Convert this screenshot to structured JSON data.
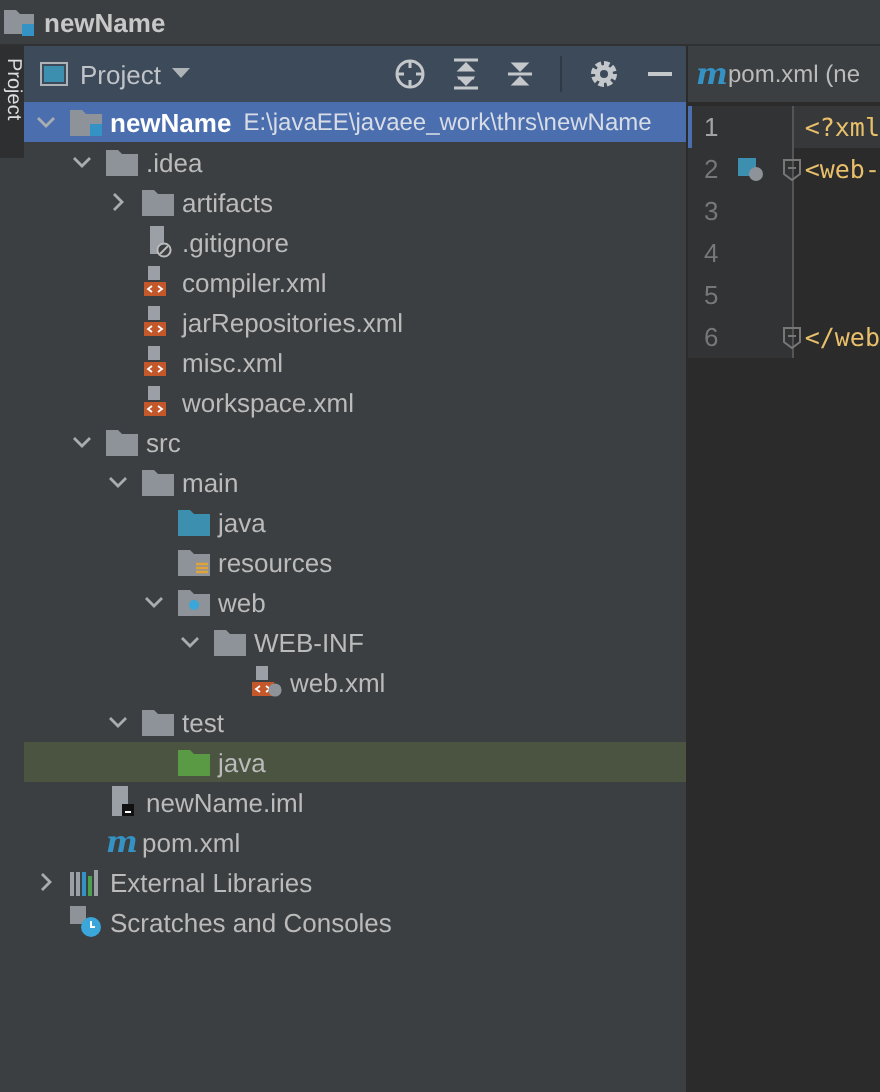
{
  "window": {
    "title": "newName"
  },
  "side_stripe": {
    "label": "Project",
    "selected": true
  },
  "panel": {
    "title": "Project",
    "toolbar": [
      {
        "kind": "locate"
      },
      {
        "kind": "expand"
      },
      {
        "kind": "collapse"
      },
      {
        "kind": "gear"
      },
      {
        "kind": "hide"
      }
    ]
  },
  "tree": [
    {
      "name": "newName",
      "path": "E:\\javaEE\\javaee_work\\thrs\\newName",
      "kind": "module",
      "expanded": true,
      "selected": true,
      "highlighted": false,
      "children": [
        {
          "name": ".idea",
          "kind": "folder",
          "expanded": true,
          "selected": false,
          "highlighted": false,
          "children": [
            {
              "name": "artifacts",
              "kind": "folder",
              "expanded": false,
              "selected": false,
              "highlighted": false
            },
            {
              "name": ".gitignore",
              "kind": "ignore",
              "selected": false,
              "highlighted": false
            },
            {
              "name": "compiler.xml",
              "kind": "xml",
              "selected": false,
              "highlighted": false
            },
            {
              "name": "jarRepositories.xml",
              "kind": "xml",
              "selected": false,
              "highlighted": false
            },
            {
              "name": "misc.xml",
              "kind": "xml",
              "selected": false,
              "highlighted": false
            },
            {
              "name": "workspace.xml",
              "kind": "xml",
              "selected": false,
              "highlighted": false
            }
          ]
        },
        {
          "name": "src",
          "kind": "folder",
          "expanded": true,
          "selected": false,
          "highlighted": false,
          "children": [
            {
              "name": "main",
              "kind": "folder",
              "expanded": true,
              "selected": false,
              "highlighted": false,
              "children": [
                {
                  "name": "java",
                  "kind": "source",
                  "selected": false,
                  "highlighted": false
                },
                {
                  "name": "resources",
                  "kind": "resources",
                  "selected": false,
                  "highlighted": false
                },
                {
                  "name": "web",
                  "kind": "web",
                  "expanded": true,
                  "selected": false,
                  "highlighted": false,
                  "children": [
                    {
                      "name": "WEB-INF",
                      "kind": "folder",
                      "expanded": true,
                      "selected": false,
                      "highlighted": false,
                      "children": [
                        {
                          "name": "web.xml",
                          "kind": "webxml",
                          "selected": false,
                          "highlighted": false
                        }
                      ]
                    }
                  ]
                }
              ]
            },
            {
              "name": "test",
              "kind": "folder",
              "expanded": true,
              "selected": false,
              "highlighted": false,
              "children": [
                {
                  "name": "java",
                  "kind": "test",
                  "selected": false,
                  "highlighted": true
                }
              ]
            }
          ]
        },
        {
          "name": "newName.iml",
          "kind": "iml",
          "selected": false,
          "highlighted": false
        },
        {
          "name": "pom.xml",
          "kind": "maven",
          "badge": "m",
          "selected": false,
          "highlighted": false
        }
      ]
    },
    {
      "name": "External Libraries",
      "kind": "libraries",
      "expanded": false,
      "selected": false,
      "highlighted": false
    },
    {
      "name": "Scratches and Consoles",
      "kind": "scratches",
      "selected": false,
      "highlighted": false
    }
  ],
  "editor": {
    "tab_icon": "m",
    "tab": "pom.xml (ne",
    "lines": [
      {
        "number": "1",
        "code": "<?xml",
        "current": true,
        "gutter_icon": false,
        "fold": false
      },
      {
        "number": "2",
        "code": "<web-",
        "current": false,
        "gutter_icon": true,
        "fold": true
      },
      {
        "number": "3",
        "current": false,
        "gutter_icon": false,
        "fold": false
      },
      {
        "number": "4",
        "current": false,
        "gutter_icon": false,
        "fold": false
      },
      {
        "number": "5",
        "current": false,
        "gutter_icon": false,
        "fold": false
      },
      {
        "number": "6",
        "code": "</web",
        "current": false,
        "gutter_icon": false,
        "fold": true
      }
    ]
  }
}
